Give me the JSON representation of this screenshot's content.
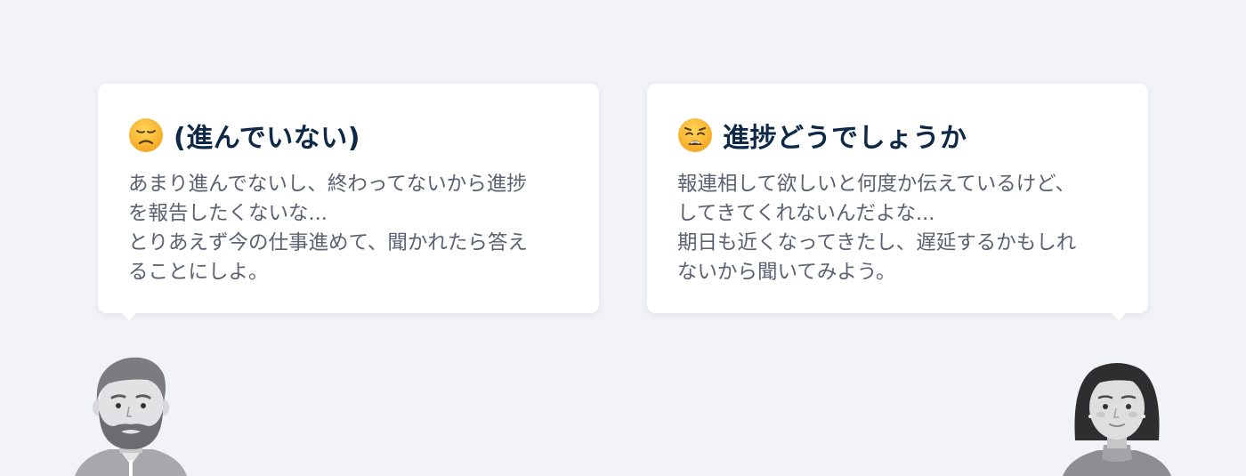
{
  "left_card": {
    "emoji_icon": "disappointed-face",
    "title": "(進んでいない)",
    "lines": [
      "あまり進んでないし、終わってないから進捗",
      "を報告したくないな...",
      "とりあえず今の仕事進めて、聞かれたら答え",
      "ることにしよ。"
    ]
  },
  "right_card": {
    "emoji_icon": "weary-face",
    "title": "進捗どうでしょうか",
    "lines": [
      "報連相して欲しいと何度か伝えているけど、",
      "してきてくれないんだよな...",
      "期日も近くなってきたし、遅延するかもしれ",
      "ないから聞いてみよう。"
    ]
  },
  "colors": {
    "background": "#f2f3f7",
    "card": "#ffffff",
    "title": "#0e2948",
    "body_text": "#5b6170"
  }
}
